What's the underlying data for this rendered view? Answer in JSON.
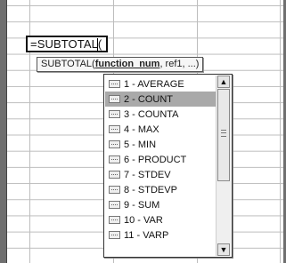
{
  "formula": {
    "text": "=SUBTOTAL("
  },
  "tooltip": {
    "prefix": "SUBTOTAL(",
    "highlighted_arg": "function_num",
    "rest": ", ref1, ...)"
  },
  "dropdown": {
    "items": [
      {
        "label": "1 - AVERAGE",
        "icon": "function-icon"
      },
      {
        "label": "2 - COUNT",
        "icon": "function-icon",
        "selected": true
      },
      {
        "label": "3 - COUNTA",
        "icon": "function-icon"
      },
      {
        "label": "4 - MAX",
        "icon": "function-icon"
      },
      {
        "label": "5 - MIN",
        "icon": "function-icon"
      },
      {
        "label": "6 - PRODUCT",
        "icon": "function-icon"
      },
      {
        "label": "7 - STDEV",
        "icon": "function-icon"
      },
      {
        "label": "8 - STDEVP",
        "icon": "function-icon"
      },
      {
        "label": "9 - SUM",
        "icon": "function-icon"
      },
      {
        "label": "10 - VAR",
        "icon": "function-icon"
      },
      {
        "label": "11 - VARP",
        "icon": "function-icon"
      }
    ],
    "selected_index": 1
  },
  "colors": {
    "background": "#6f6f6f",
    "selection": "#a9a9a9",
    "grid": "#bdbdbd"
  }
}
